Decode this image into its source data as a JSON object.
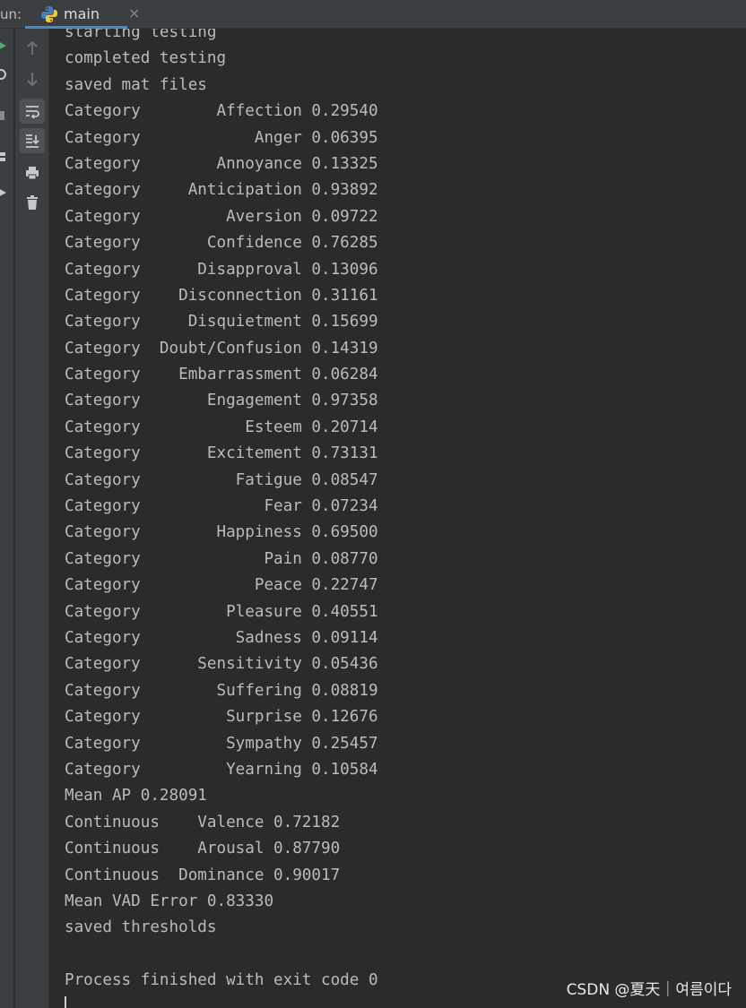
{
  "header": {
    "run_label": "un:",
    "tab_label": "main",
    "tab_close": "×"
  },
  "toolbar": {
    "buttons": [
      {
        "icon": "arrow-up-icon"
      },
      {
        "icon": "arrow-down-icon"
      },
      {
        "icon": "soft-wrap-icon"
      },
      {
        "icon": "scroll-to-end-icon"
      },
      {
        "icon": "print-icon"
      },
      {
        "icon": "trash-icon"
      }
    ]
  },
  "console": {
    "lines": [
      "starting testing",
      "completed testing",
      "saved mat files",
      "Category        Affection 0.29540",
      "Category            Anger 0.06395",
      "Category        Annoyance 0.13325",
      "Category     Anticipation 0.93892",
      "Category         Aversion 0.09722",
      "Category       Confidence 0.76285",
      "Category      Disapproval 0.13096",
      "Category    Disconnection 0.31161",
      "Category     Disquietment 0.15699",
      "Category  Doubt/Confusion 0.14319",
      "Category    Embarrassment 0.06284",
      "Category       Engagement 0.97358",
      "Category           Esteem 0.20714",
      "Category       Excitement 0.73131",
      "Category          Fatigue 0.08547",
      "Category             Fear 0.07234",
      "Category        Happiness 0.69500",
      "Category             Pain 0.08770",
      "Category            Peace 0.22747",
      "Category         Pleasure 0.40551",
      "Category          Sadness 0.09114",
      "Category      Sensitivity 0.05436",
      "Category        Suffering 0.08819",
      "Category         Surprise 0.12676",
      "Category         Sympathy 0.25457",
      "Category         Yearning 0.10584",
      "Mean AP 0.28091",
      "Continuous    Valence 0.72182",
      "Continuous    Arousal 0.87790",
      "Continuous  Dominance 0.90017",
      "Mean VAD Error 0.83330",
      "saved thresholds",
      "",
      "Process finished with exit code 0"
    ]
  },
  "watermark": "CSDN @夏天｜여름이다",
  "colors": {
    "background": "#2b2b2b",
    "panel": "#3c3f41",
    "text": "#bbbbbb",
    "tab_underline": "#4a88c7"
  }
}
